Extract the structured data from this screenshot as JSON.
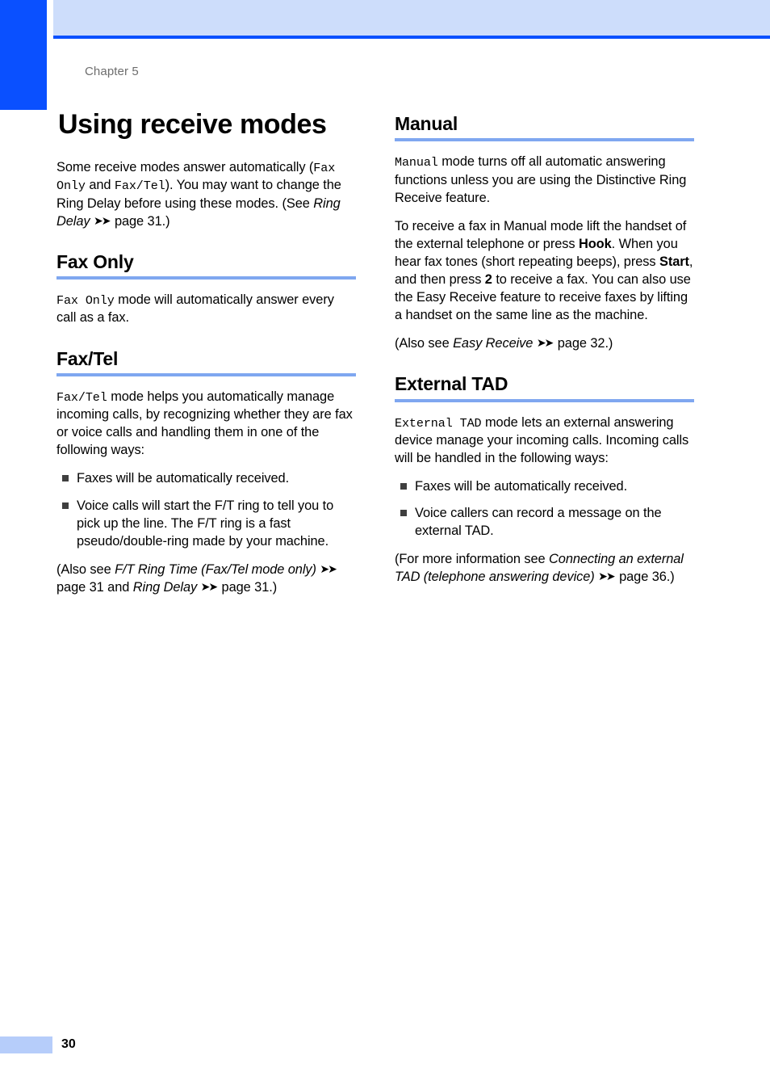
{
  "header": {
    "chapter_label": "Chapter 5",
    "band_color": "#cdddfb",
    "rule_color": "#0a50ff",
    "tab_color": "#0a50ff"
  },
  "page_title": "Using receive modes",
  "section_rule_color": "#7fa7f0",
  "left_column": {
    "intro": {
      "t1": "Some receive modes answer automatically (",
      "mono1": "Fax Only",
      "t2": " and ",
      "mono2": "Fax/Tel",
      "t3": "). You may want to change the Ring Delay before using these modes. (See ",
      "ital1": "Ring Delay",
      "t4": " ",
      "arrows1": "➤➤",
      "t5": " page 31.)"
    },
    "fax_only": {
      "title": "Fax Only",
      "p1_mono": "Fax Only",
      "p1_text": " mode will automatically answer every call as a fax."
    },
    "fax_tel": {
      "title": "Fax/Tel",
      "p1_mono": "Fax/Tel",
      "p1_text": " mode helps you automatically manage incoming calls, by recognizing whether they are fax or voice calls and handling them in one of the following ways:",
      "bullets": [
        "Faxes will be automatically received.",
        "Voice calls will start the F/T ring to tell you to pick up the line. The F/T ring is a fast pseudo/double-ring made by your machine."
      ],
      "note": {
        "t1": "(Also see ",
        "ital1": "F/T Ring Time (Fax/Tel mode only)",
        "t2": " ",
        "arrows1": "➤➤",
        "t3": " page 31 and ",
        "ital2": "Ring Delay",
        "t4": " ",
        "arrows2": "➤➤",
        "t5": " page 31.)"
      }
    }
  },
  "right_column": {
    "manual": {
      "title": "Manual",
      "p1_mono": "Manual",
      "p1_text": " mode turns off all automatic answering functions unless you are using the Distinctive Ring Receive feature.",
      "p2": {
        "t1": "To receive a fax in Manual mode lift the handset of the external telephone or press ",
        "b1": "Hook",
        "t2": ". When you hear fax tones (short repeating beeps), press ",
        "b2": "Start",
        "t3": ", and then press ",
        "b3": "2",
        "t4": " to receive a fax. You can also use the Easy Receive feature to receive faxes by lifting a handset on the same line as the machine."
      },
      "note": {
        "t1": "(Also see ",
        "ital1": "Easy Receive",
        "t2": " ",
        "arrows1": "➤➤",
        "t3": " page 32.)"
      }
    },
    "external_tad": {
      "title": "External TAD",
      "p1_mono": "External TAD",
      "p1_text": " mode lets an external answering device manage your incoming calls. Incoming calls will be handled in the following ways:",
      "bullets": [
        "Faxes will be automatically received.",
        "Voice callers can record a message on the external TAD."
      ],
      "note": {
        "t1": "(For more information see ",
        "ital1": "Connecting an external TAD (telephone answering device)",
        "t2": " ",
        "arrows1": "➤➤",
        "t3": " page 36.)"
      }
    }
  },
  "footer": {
    "page_number": "30",
    "bar_color": "#b6cdfa"
  }
}
